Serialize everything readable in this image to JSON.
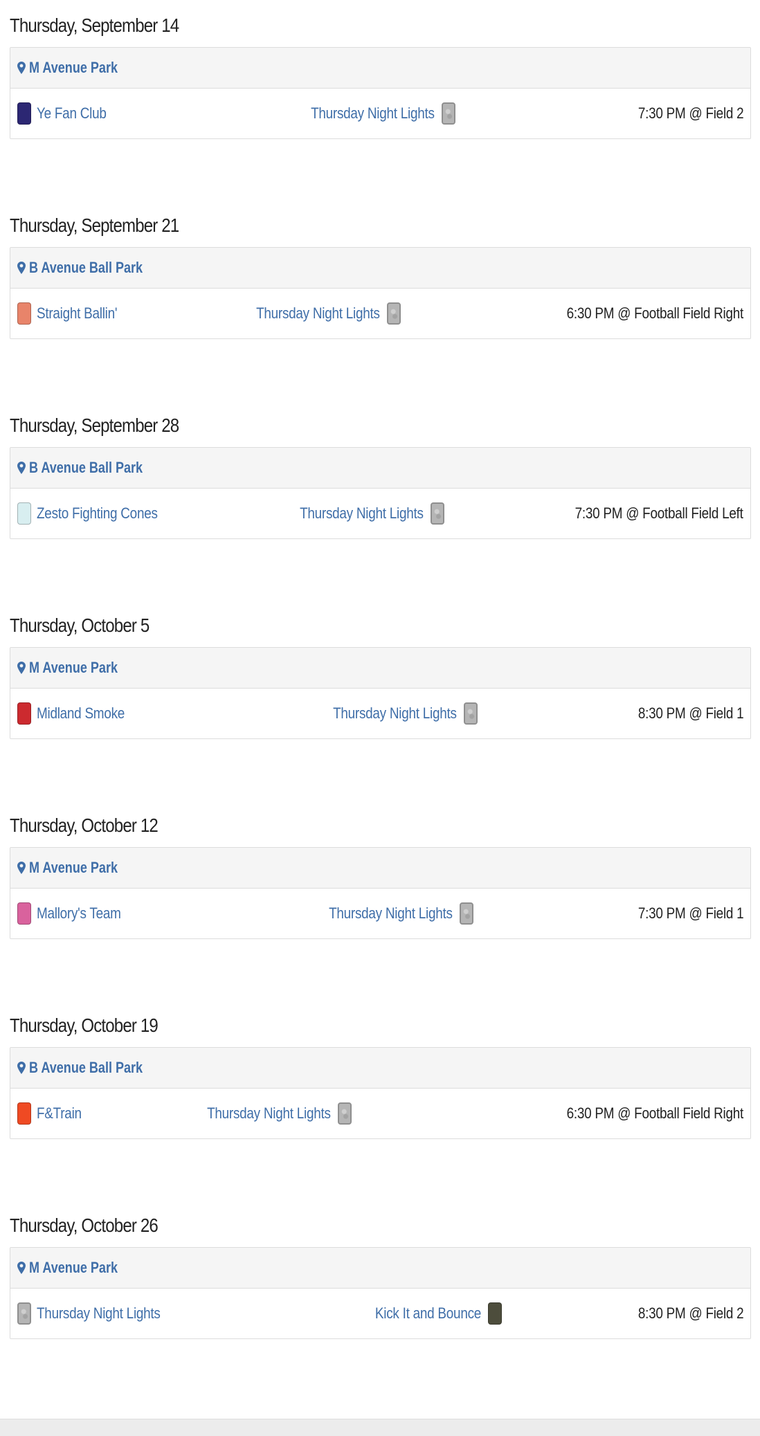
{
  "days": [
    {
      "date": "Thursday, September 14",
      "location": "M Avenue Park",
      "team_left": {
        "name": "Ye Fan Club",
        "color": "#2c2773"
      },
      "team_mid": {
        "name": "Thursday Night Lights",
        "color": "#b5b5b5"
      },
      "time": "7:30 PM @ Field 2"
    },
    {
      "date": "Thursday, September 21",
      "location": "B Avenue Ball Park",
      "team_left": {
        "name": "Straight Ballin'",
        "color": "#e8846a"
      },
      "team_mid": {
        "name": "Thursday Night Lights",
        "color": "#b5b5b5"
      },
      "time": "6:30 PM @ Football Field Right"
    },
    {
      "date": "Thursday, September 28",
      "location": "B Avenue Ball Park",
      "team_left": {
        "name": "Zesto Fighting Cones",
        "color": "#d8eef0"
      },
      "team_mid": {
        "name": "Thursday Night Lights",
        "color": "#b5b5b5"
      },
      "time": "7:30 PM @ Football Field Left"
    },
    {
      "date": "Thursday, October 5",
      "location": "M Avenue Park",
      "team_left": {
        "name": "Midland Smoke",
        "color": "#cc2a2f"
      },
      "team_mid": {
        "name": "Thursday Night Lights",
        "color": "#b5b5b5"
      },
      "time": "8:30 PM @ Field 1"
    },
    {
      "date": "Thursday, October 12",
      "location": "M Avenue Park",
      "team_left": {
        "name": "Mallory's Team",
        "color": "#d9629d"
      },
      "team_mid": {
        "name": "Thursday Night Lights",
        "color": "#b5b5b5"
      },
      "time": "7:30 PM @ Field 1"
    },
    {
      "date": "Thursday, October 19",
      "location": "B Avenue Ball Park",
      "team_left": {
        "name": "F&Train",
        "color": "#ef4a23"
      },
      "team_mid": {
        "name": "Thursday Night Lights",
        "color": "#b5b5b5"
      },
      "time": "6:30 PM @ Football Field Right"
    },
    {
      "date": "Thursday, October 26",
      "location": "M Avenue Park",
      "team_left": {
        "name": "Thursday Night Lights",
        "color": "#b5b5b5"
      },
      "team_mid": {
        "name": "Kick It and Bounce",
        "color": "#4d4d3c"
      },
      "time": "8:30 PM @ Field 2"
    }
  ],
  "colors": {
    "link": "#3f6ea8",
    "row_bg": "#f5f5f5",
    "border": "#dcdcdc"
  }
}
